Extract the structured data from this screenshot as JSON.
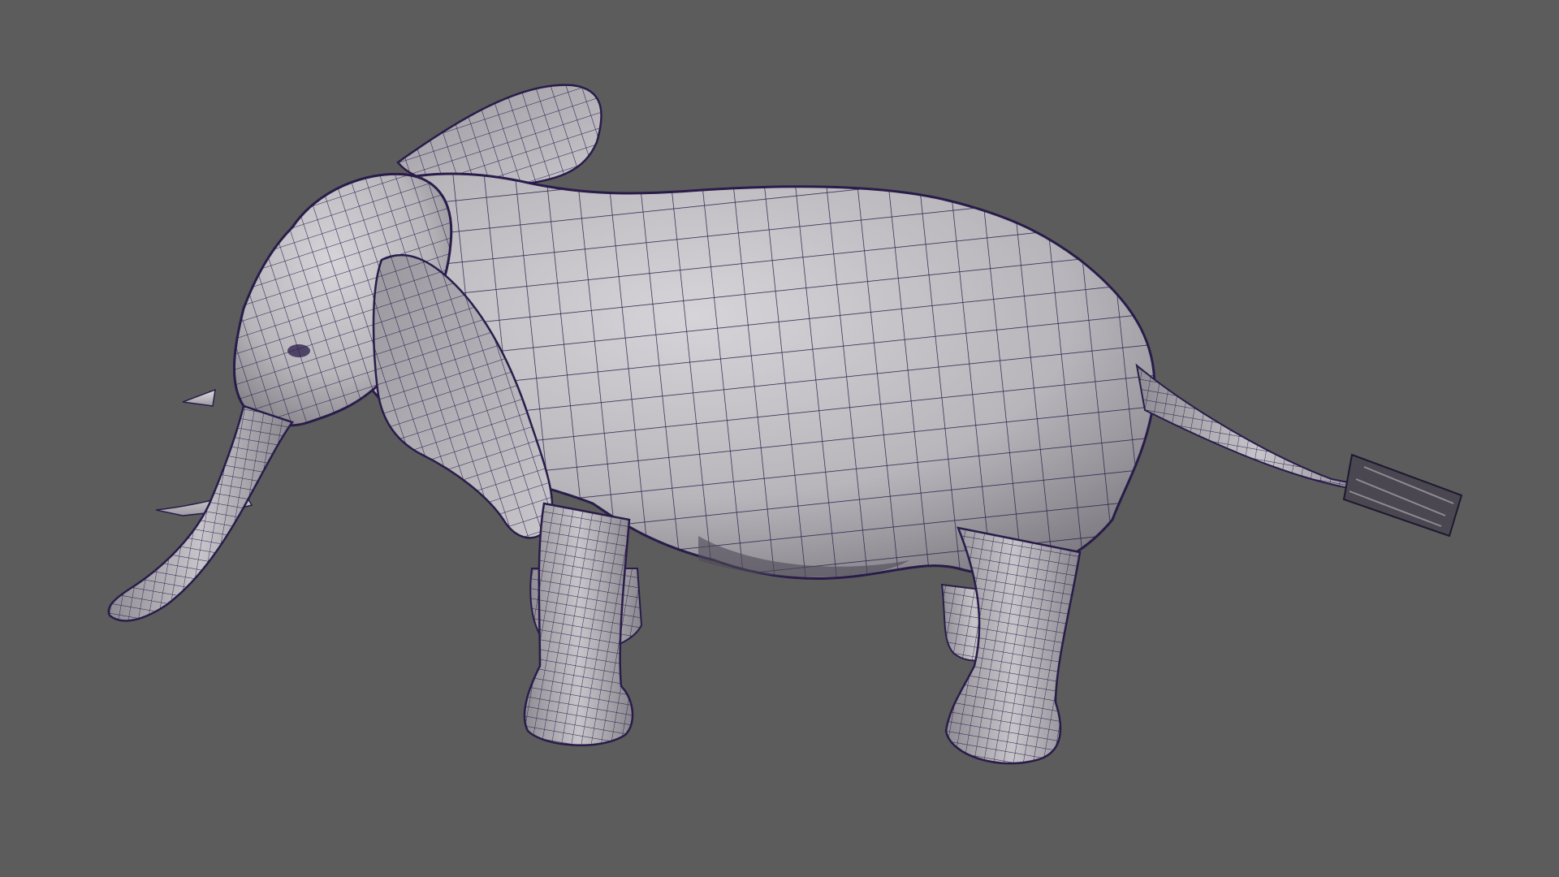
{
  "viewport": {
    "background_color": "#5c5c5c",
    "shading_mode": "wireframe-on-shaded",
    "mesh_base_color": "#a9a7ab",
    "mesh_highlight_color": "#d6d4d8",
    "mesh_shadow_color": "#6e6b72",
    "wireframe_color": "#2a1c4a",
    "selected_object": "elephant-mesh"
  }
}
